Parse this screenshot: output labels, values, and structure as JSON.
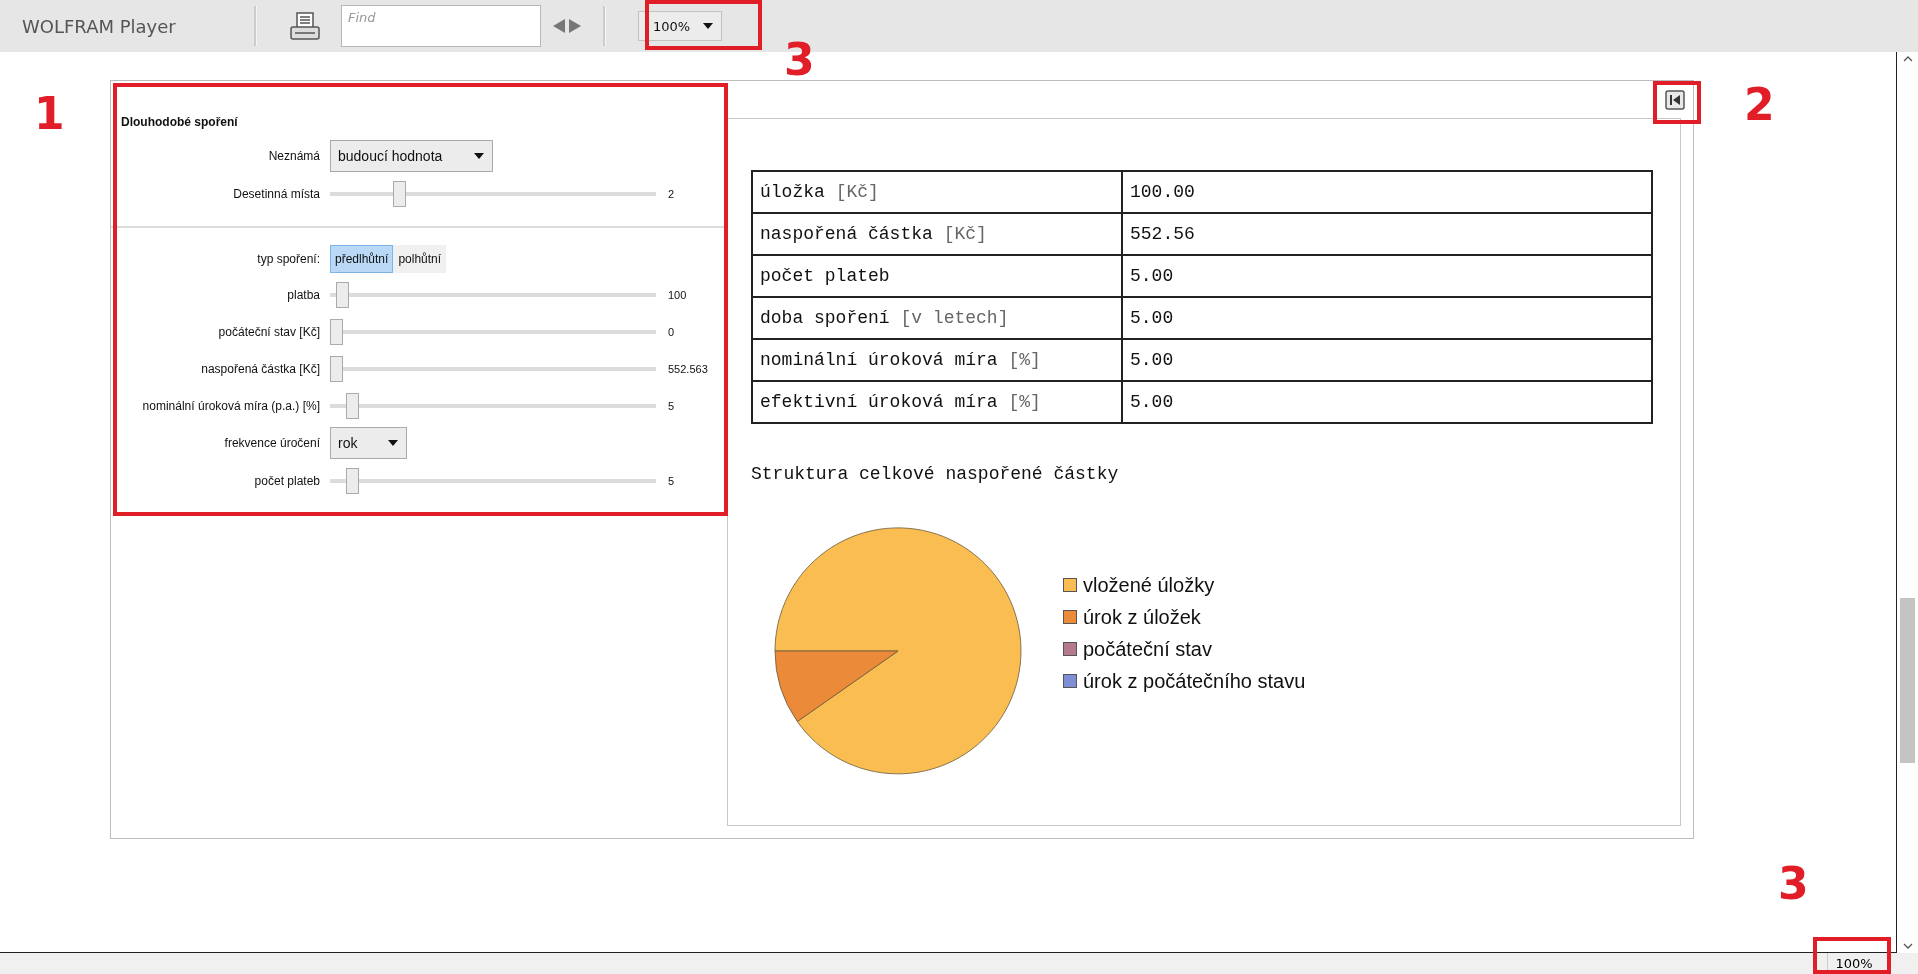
{
  "app": {
    "title": "WOLFRAM Player",
    "find": {
      "placeholder": "Find"
    },
    "zoom": "100%"
  },
  "panel": {
    "title": "Dlouhodobé spoření",
    "controls": [
      {
        "kind": "dropdown",
        "label": "Neznámá",
        "value": "budoucí hodnota"
      },
      {
        "kind": "slider",
        "label": "Desetinná místa",
        "level": 0.2,
        "reading": "2"
      },
      {
        "kind": "divider"
      },
      {
        "kind": "toggle",
        "label": "typ spoření:",
        "options": [
          {
            "label": "předlhůtní",
            "selected": true
          },
          {
            "label": "polhůtní",
            "selected": false
          }
        ]
      },
      {
        "kind": "slider",
        "label": "platba",
        "level": 0.02,
        "reading": "100"
      },
      {
        "kind": "slider",
        "label": "počáteční stav [Kč]",
        "level": 0,
        "reading": "0"
      },
      {
        "kind": "slider",
        "label": "naspořená částka [Kč]",
        "level": 0,
        "reading": "552.563"
      },
      {
        "kind": "slider",
        "label": "nominální úroková míra (p.a.) [%]",
        "level": 0.05,
        "reading": "5"
      },
      {
        "kind": "dropdown",
        "label": "frekvence úročení",
        "value": "rok",
        "narrow": true
      },
      {
        "kind": "slider",
        "label": "počet plateb",
        "level": 0.05,
        "reading": "5"
      }
    ]
  },
  "output": {
    "table": {
      "rows": [
        {
          "label": "úložka",
          "unit": "[Kč]",
          "value": "100.00"
        },
        {
          "label": "naspořená částka",
          "unit": "[Kč]",
          "value": "552.56"
        },
        {
          "label": "počet plateb",
          "value": "5.00"
        },
        {
          "label": "doba spoření",
          "unit": "[v letech]",
          "value": "5.00"
        },
        {
          "label": "nominální úroková míra",
          "unit": "[%]",
          "value": "5.00"
        },
        {
          "label": "efektivní úroková míra",
          "unit": "[%]",
          "value": "5.00"
        }
      ]
    },
    "chart": {
      "title": "Struktura celkové naspořené částky",
      "legend": [
        {
          "label": "vložené úložky",
          "color": "#f9bd52"
        },
        {
          "label": "úrok z úložek",
          "color": "#eb8a38"
        },
        {
          "label": "počáteční stav",
          "color": "#b57b8c"
        },
        {
          "label": "úrok z počátečního stavu",
          "color": "#7f8fd6"
        }
      ]
    }
  },
  "status_bar": {
    "zoom": "100%"
  },
  "annotations": [
    {
      "label": "1"
    },
    {
      "label": "3"
    },
    {
      "label": "2"
    },
    {
      "label": "3"
    }
  ]
}
